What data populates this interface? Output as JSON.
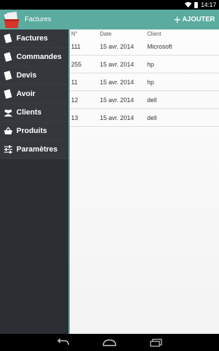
{
  "status": {
    "time": "14:17"
  },
  "actionbar": {
    "title": "Factures",
    "add_label": "AJOUTER"
  },
  "sidebar": {
    "items": [
      {
        "label": "Factures",
        "icon": "document-icon"
      },
      {
        "label": "Commandes",
        "icon": "document-icon"
      },
      {
        "label": "Devis",
        "icon": "document-icon"
      },
      {
        "label": "Avoir",
        "icon": "document-icon"
      },
      {
        "label": "Clients",
        "icon": "people-icon"
      },
      {
        "label": "Produits",
        "icon": "basket-icon"
      },
      {
        "label": "Paramètres",
        "icon": "sliders-icon"
      }
    ]
  },
  "table": {
    "headers": {
      "num": "N°",
      "date": "Date",
      "client": "Client"
    },
    "rows": [
      {
        "num": "111",
        "date": "15 avr. 2014",
        "client": "Microsoft"
      },
      {
        "num": "255",
        "date": "15 avr. 2014",
        "client": "hp"
      },
      {
        "num": "11",
        "date": "15 avr. 2014",
        "client": "hp"
      },
      {
        "num": "12",
        "date": "15 avr. 2014",
        "client": "dell"
      },
      {
        "num": "13",
        "date": "15 avr. 2014",
        "client": "dell"
      }
    ]
  },
  "colors": {
    "accent": "#5bab9f",
    "sidebar": "#34373c",
    "logo": "#d9342b"
  }
}
